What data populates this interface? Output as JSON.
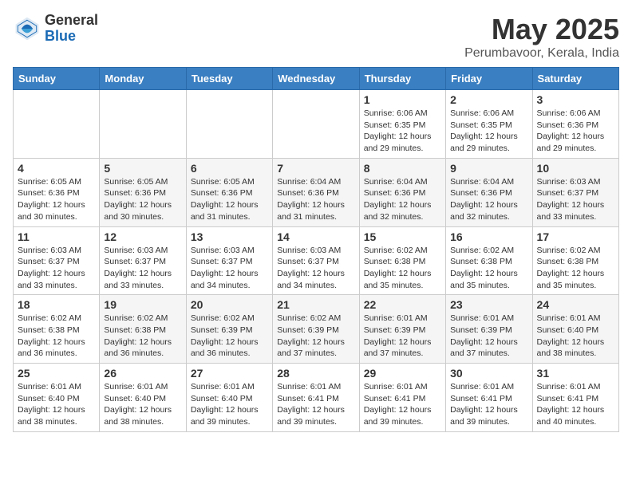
{
  "header": {
    "logo_general": "General",
    "logo_blue": "Blue",
    "month_title": "May 2025",
    "location": "Perumbavoor, Kerala, India"
  },
  "weekdays": [
    "Sunday",
    "Monday",
    "Tuesday",
    "Wednesday",
    "Thursday",
    "Friday",
    "Saturday"
  ],
  "rows": [
    [
      {
        "num": "",
        "sunrise": "",
        "sunset": "",
        "daylight": ""
      },
      {
        "num": "",
        "sunrise": "",
        "sunset": "",
        "daylight": ""
      },
      {
        "num": "",
        "sunrise": "",
        "sunset": "",
        "daylight": ""
      },
      {
        "num": "",
        "sunrise": "",
        "sunset": "",
        "daylight": ""
      },
      {
        "num": "1",
        "sunrise": "Sunrise: 6:06 AM",
        "sunset": "Sunset: 6:35 PM",
        "daylight": "Daylight: 12 hours and 29 minutes."
      },
      {
        "num": "2",
        "sunrise": "Sunrise: 6:06 AM",
        "sunset": "Sunset: 6:35 PM",
        "daylight": "Daylight: 12 hours and 29 minutes."
      },
      {
        "num": "3",
        "sunrise": "Sunrise: 6:06 AM",
        "sunset": "Sunset: 6:36 PM",
        "daylight": "Daylight: 12 hours and 29 minutes."
      }
    ],
    [
      {
        "num": "4",
        "sunrise": "Sunrise: 6:05 AM",
        "sunset": "Sunset: 6:36 PM",
        "daylight": "Daylight: 12 hours and 30 minutes."
      },
      {
        "num": "5",
        "sunrise": "Sunrise: 6:05 AM",
        "sunset": "Sunset: 6:36 PM",
        "daylight": "Daylight: 12 hours and 30 minutes."
      },
      {
        "num": "6",
        "sunrise": "Sunrise: 6:05 AM",
        "sunset": "Sunset: 6:36 PM",
        "daylight": "Daylight: 12 hours and 31 minutes."
      },
      {
        "num": "7",
        "sunrise": "Sunrise: 6:04 AM",
        "sunset": "Sunset: 6:36 PM",
        "daylight": "Daylight: 12 hours and 31 minutes."
      },
      {
        "num": "8",
        "sunrise": "Sunrise: 6:04 AM",
        "sunset": "Sunset: 6:36 PM",
        "daylight": "Daylight: 12 hours and 32 minutes."
      },
      {
        "num": "9",
        "sunrise": "Sunrise: 6:04 AM",
        "sunset": "Sunset: 6:36 PM",
        "daylight": "Daylight: 12 hours and 32 minutes."
      },
      {
        "num": "10",
        "sunrise": "Sunrise: 6:03 AM",
        "sunset": "Sunset: 6:37 PM",
        "daylight": "Daylight: 12 hours and 33 minutes."
      }
    ],
    [
      {
        "num": "11",
        "sunrise": "Sunrise: 6:03 AM",
        "sunset": "Sunset: 6:37 PM",
        "daylight": "Daylight: 12 hours and 33 minutes."
      },
      {
        "num": "12",
        "sunrise": "Sunrise: 6:03 AM",
        "sunset": "Sunset: 6:37 PM",
        "daylight": "Daylight: 12 hours and 33 minutes."
      },
      {
        "num": "13",
        "sunrise": "Sunrise: 6:03 AM",
        "sunset": "Sunset: 6:37 PM",
        "daylight": "Daylight: 12 hours and 34 minutes."
      },
      {
        "num": "14",
        "sunrise": "Sunrise: 6:03 AM",
        "sunset": "Sunset: 6:37 PM",
        "daylight": "Daylight: 12 hours and 34 minutes."
      },
      {
        "num": "15",
        "sunrise": "Sunrise: 6:02 AM",
        "sunset": "Sunset: 6:38 PM",
        "daylight": "Daylight: 12 hours and 35 minutes."
      },
      {
        "num": "16",
        "sunrise": "Sunrise: 6:02 AM",
        "sunset": "Sunset: 6:38 PM",
        "daylight": "Daylight: 12 hours and 35 minutes."
      },
      {
        "num": "17",
        "sunrise": "Sunrise: 6:02 AM",
        "sunset": "Sunset: 6:38 PM",
        "daylight": "Daylight: 12 hours and 35 minutes."
      }
    ],
    [
      {
        "num": "18",
        "sunrise": "Sunrise: 6:02 AM",
        "sunset": "Sunset: 6:38 PM",
        "daylight": "Daylight: 12 hours and 36 minutes."
      },
      {
        "num": "19",
        "sunrise": "Sunrise: 6:02 AM",
        "sunset": "Sunset: 6:38 PM",
        "daylight": "Daylight: 12 hours and 36 minutes."
      },
      {
        "num": "20",
        "sunrise": "Sunrise: 6:02 AM",
        "sunset": "Sunset: 6:39 PM",
        "daylight": "Daylight: 12 hours and 36 minutes."
      },
      {
        "num": "21",
        "sunrise": "Sunrise: 6:02 AM",
        "sunset": "Sunset: 6:39 PM",
        "daylight": "Daylight: 12 hours and 37 minutes."
      },
      {
        "num": "22",
        "sunrise": "Sunrise: 6:01 AM",
        "sunset": "Sunset: 6:39 PM",
        "daylight": "Daylight: 12 hours and 37 minutes."
      },
      {
        "num": "23",
        "sunrise": "Sunrise: 6:01 AM",
        "sunset": "Sunset: 6:39 PM",
        "daylight": "Daylight: 12 hours and 37 minutes."
      },
      {
        "num": "24",
        "sunrise": "Sunrise: 6:01 AM",
        "sunset": "Sunset: 6:40 PM",
        "daylight": "Daylight: 12 hours and 38 minutes."
      }
    ],
    [
      {
        "num": "25",
        "sunrise": "Sunrise: 6:01 AM",
        "sunset": "Sunset: 6:40 PM",
        "daylight": "Daylight: 12 hours and 38 minutes."
      },
      {
        "num": "26",
        "sunrise": "Sunrise: 6:01 AM",
        "sunset": "Sunset: 6:40 PM",
        "daylight": "Daylight: 12 hours and 38 minutes."
      },
      {
        "num": "27",
        "sunrise": "Sunrise: 6:01 AM",
        "sunset": "Sunset: 6:40 PM",
        "daylight": "Daylight: 12 hours and 39 minutes."
      },
      {
        "num": "28",
        "sunrise": "Sunrise: 6:01 AM",
        "sunset": "Sunset: 6:41 PM",
        "daylight": "Daylight: 12 hours and 39 minutes."
      },
      {
        "num": "29",
        "sunrise": "Sunrise: 6:01 AM",
        "sunset": "Sunset: 6:41 PM",
        "daylight": "Daylight: 12 hours and 39 minutes."
      },
      {
        "num": "30",
        "sunrise": "Sunrise: 6:01 AM",
        "sunset": "Sunset: 6:41 PM",
        "daylight": "Daylight: 12 hours and 39 minutes."
      },
      {
        "num": "31",
        "sunrise": "Sunrise: 6:01 AM",
        "sunset": "Sunset: 6:41 PM",
        "daylight": "Daylight: 12 hours and 40 minutes."
      }
    ]
  ]
}
